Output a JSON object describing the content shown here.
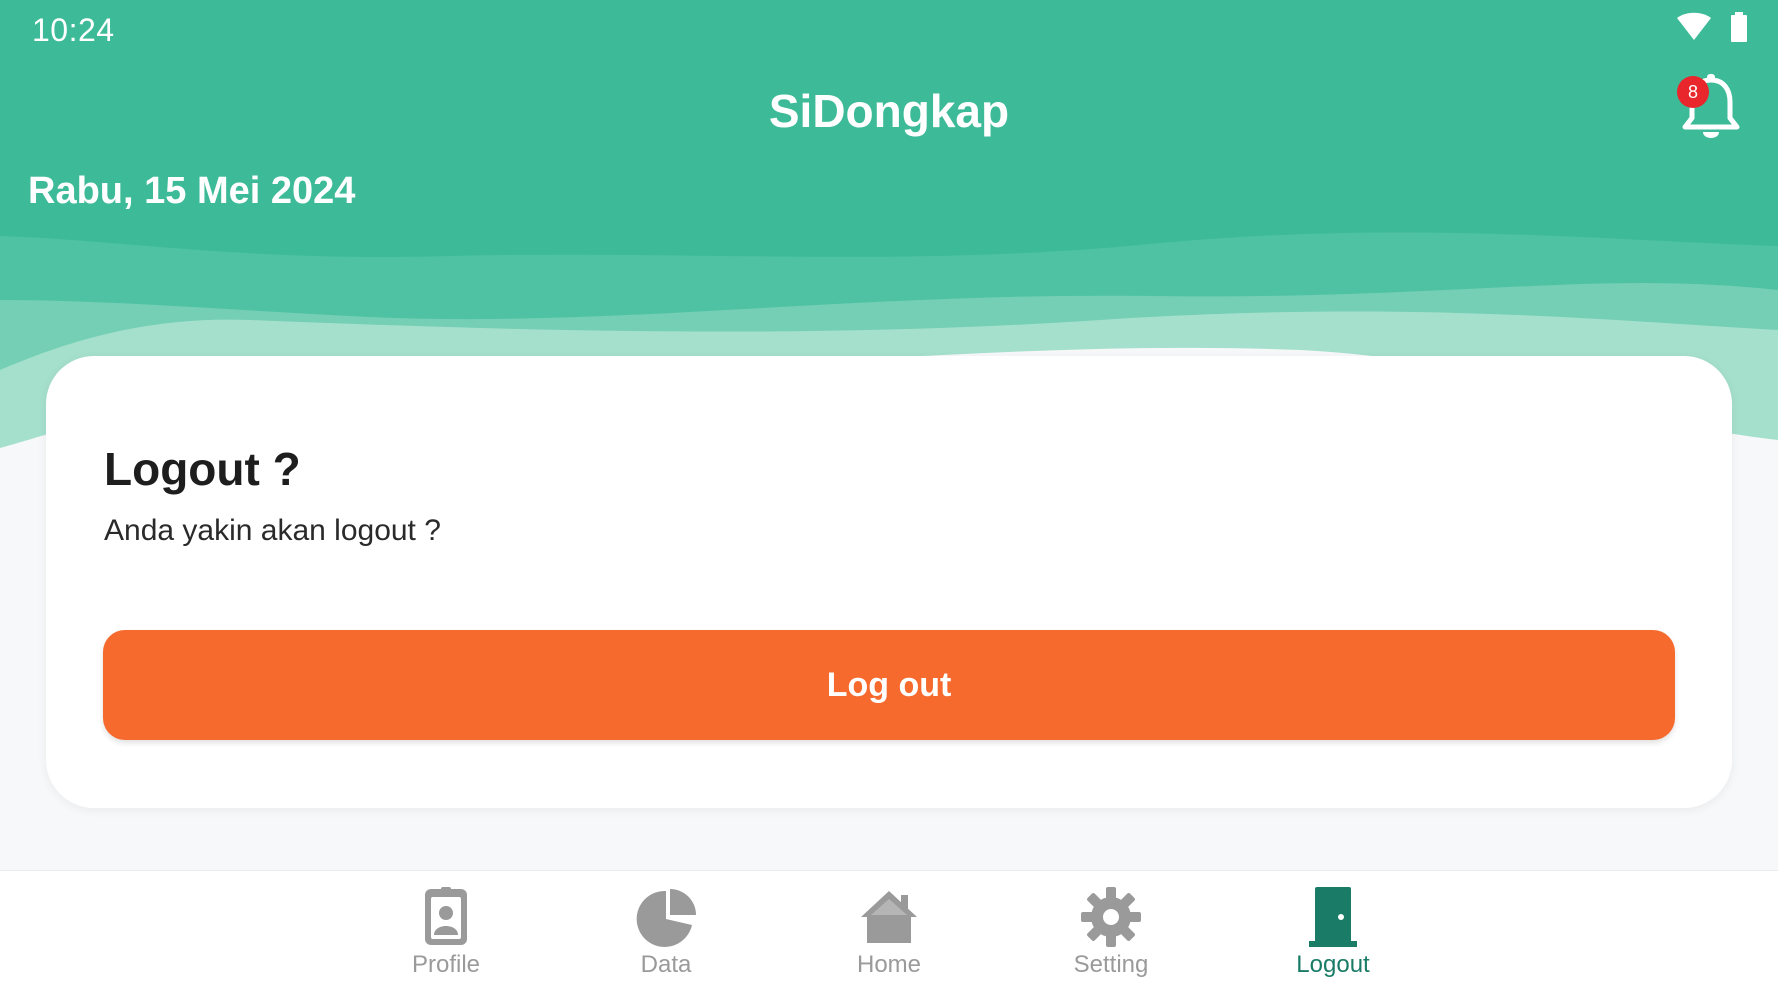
{
  "status_bar": {
    "time": "10:24",
    "icons": [
      "wifi-icon",
      "battery-icon"
    ]
  },
  "header": {
    "title": "SiDongkap",
    "date": "Rabu, 15 Mei 2024",
    "notification_count": "8"
  },
  "dialog": {
    "title": "Logout ?",
    "message": "Anda yakin akan logout ?",
    "button_label": "Log out"
  },
  "bottom_nav": {
    "items": [
      {
        "label": "Profile",
        "icon": "profile-badge-icon"
      },
      {
        "label": "Data",
        "icon": "pie-chart-icon"
      },
      {
        "label": "Home",
        "icon": "home-icon"
      },
      {
        "label": "Setting",
        "icon": "gear-icon"
      },
      {
        "label": "Logout",
        "icon": "door-icon"
      }
    ],
    "active": "Logout"
  },
  "colors": {
    "header_green": "#3dbb98",
    "accent_orange": "#f66a2e",
    "active_nav": "#1a7c66",
    "inactive_nav": "#9a9a9a",
    "badge_red": "#e8262b"
  }
}
